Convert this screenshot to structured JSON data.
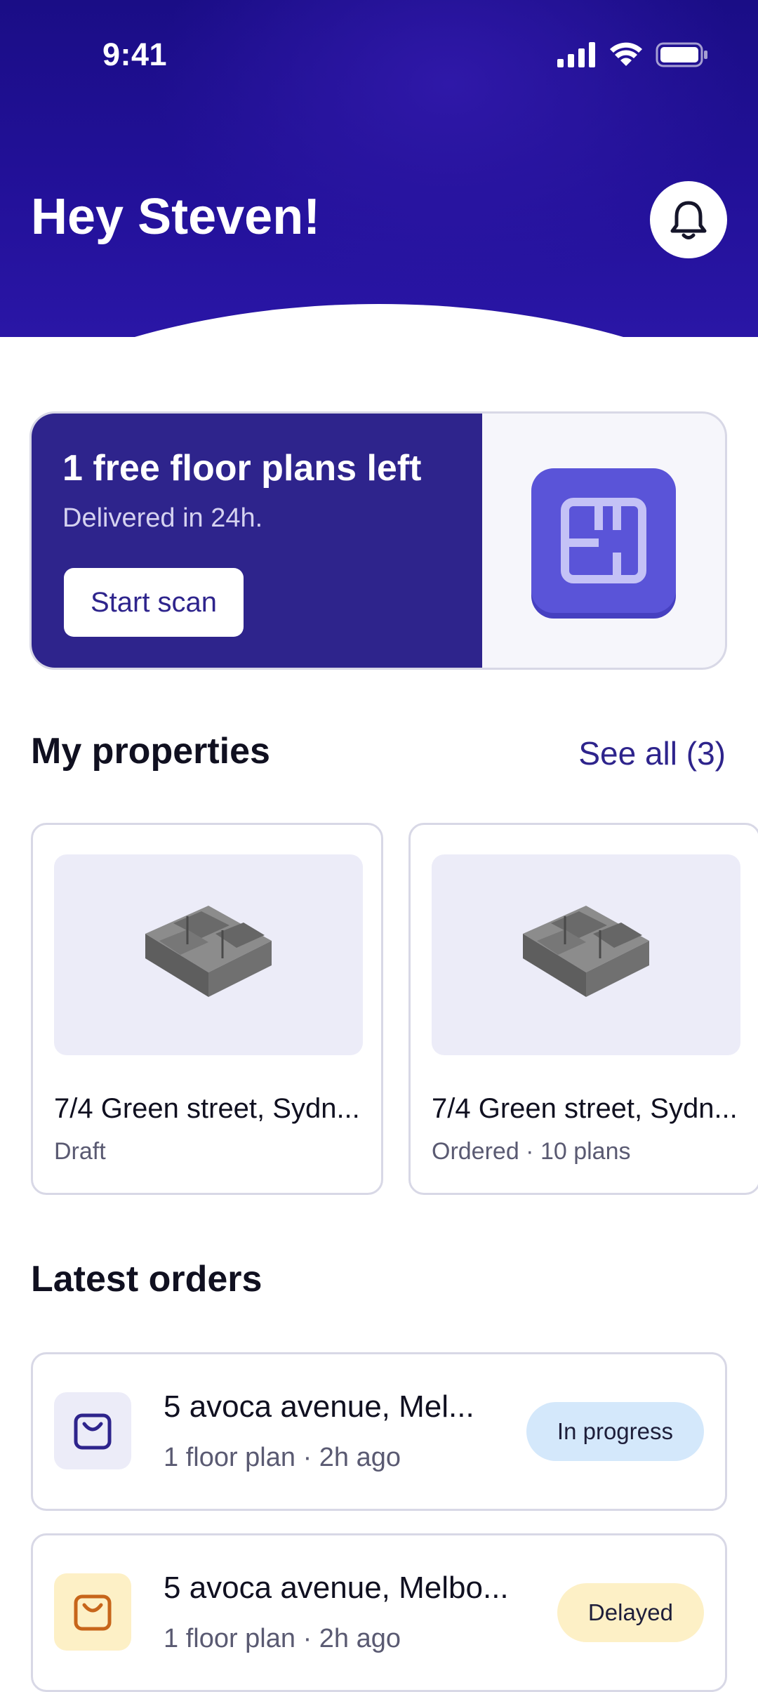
{
  "status_bar": {
    "time": "9:41"
  },
  "header": {
    "greeting": "Hey Steven!"
  },
  "promo": {
    "title": "1 free floor plans left",
    "subtitle": "Delivered in 24h.",
    "button_label": "Start scan"
  },
  "properties": {
    "title": "My properties",
    "see_all": "See all (3)",
    "items": [
      {
        "address": "7/4 Green street, Sydn...",
        "status": "Draft"
      },
      {
        "address": "7/4 Green street, Sydn...",
        "status": "Ordered · 10 plans"
      }
    ]
  },
  "orders": {
    "title": "Latest orders",
    "items": [
      {
        "address": "5 avoca avenue, Mel...",
        "meta": "1 floor plan · 2h ago",
        "badge": "In progress",
        "badge_color": "#d4e8fb",
        "icon_bg": "#ececf8",
        "icon_color": "#2e248c"
      },
      {
        "address": "5 avoca avenue, Melbo...",
        "meta": "1 floor plan · 2h ago",
        "badge": "Delayed",
        "badge_color": "#fdf0c6",
        "icon_bg": "#fdf0c6",
        "icon_color": "#c7651a"
      }
    ]
  },
  "colors": {
    "brand": "#2e248c",
    "header": "#1a0d86"
  }
}
